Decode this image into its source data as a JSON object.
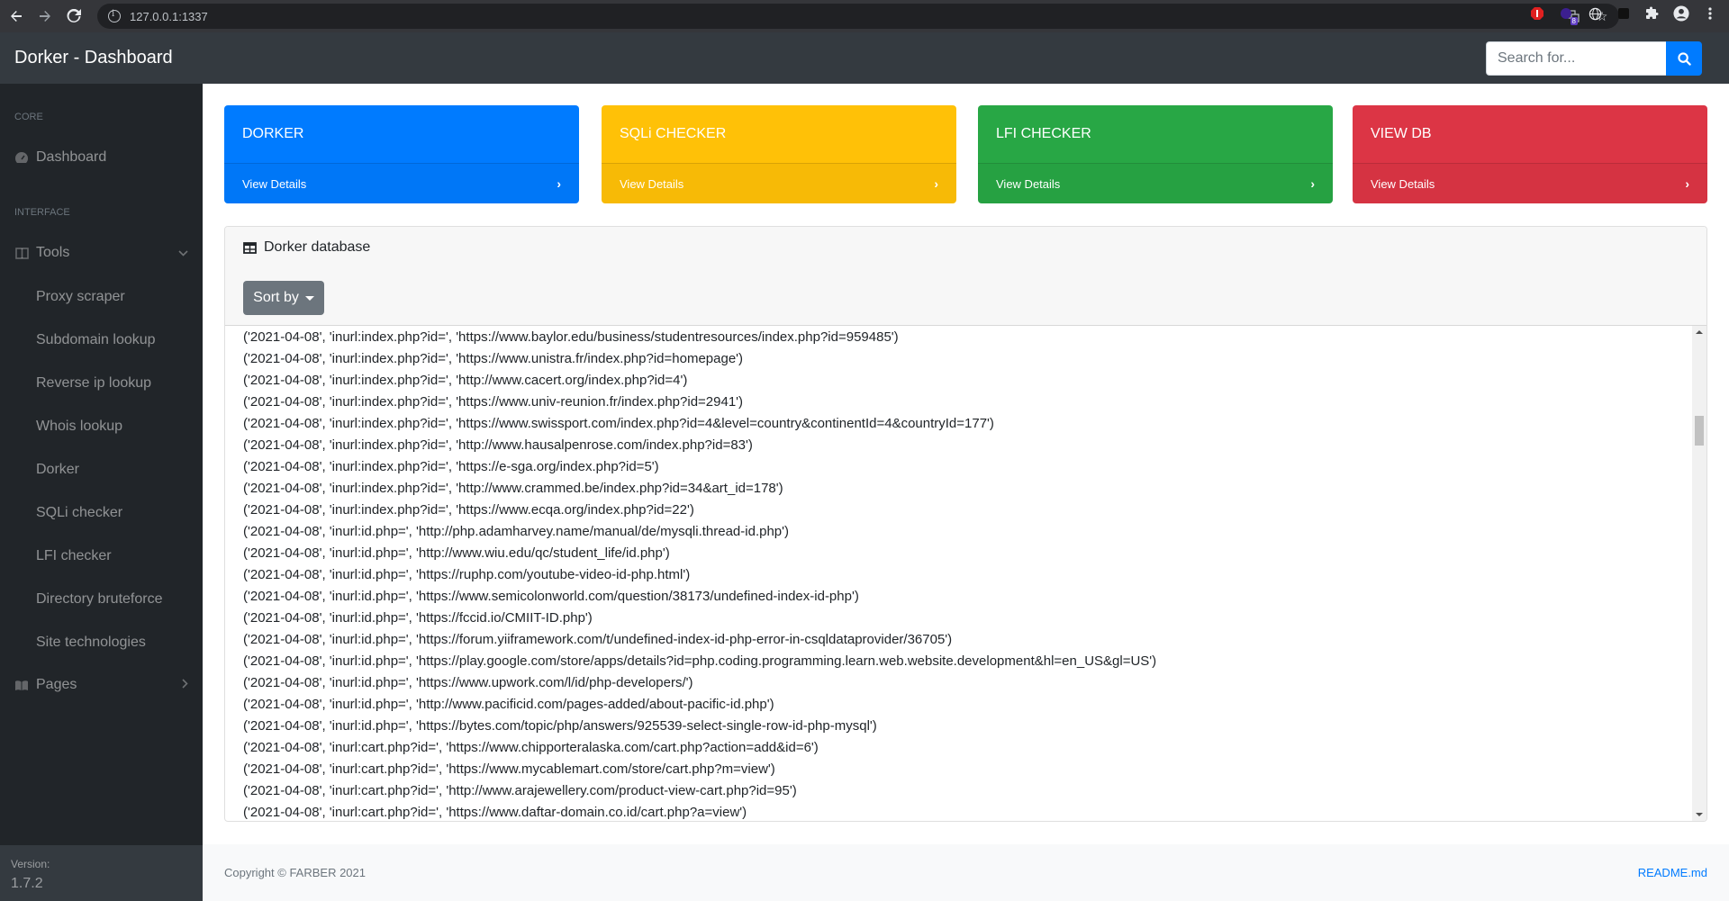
{
  "browser": {
    "url": "127.0.0.1:1337",
    "extension_badge": "8"
  },
  "topnav": {
    "brand": "Dorker - Dashboard",
    "search_placeholder": "Search for..."
  },
  "sidebar": {
    "heading_core": "Core",
    "heading_interface": "Interface",
    "dashboard": "Dashboard",
    "tools": "Tools",
    "tools_items": [
      "Proxy scraper",
      "Subdomain lookup",
      "Reverse ip lookup",
      "Whois lookup",
      "Dorker",
      "SQLi checker",
      "LFI checker",
      "Directory bruteforce",
      "Site technologies"
    ],
    "pages": "Pages",
    "version_label": "Version:",
    "version": "1.7.2"
  },
  "cards": [
    {
      "title": "DORKER",
      "link": "View Details",
      "color": "#007bff",
      "text": "#ffffff"
    },
    {
      "title": "SQLi CHECKER",
      "link": "View Details",
      "color": "#ffc107",
      "text": "#ffffff"
    },
    {
      "title": "LFI CHECKER",
      "link": "View Details",
      "color": "#28a745",
      "text": "#ffffff"
    },
    {
      "title": "VIEW DB",
      "link": "View Details",
      "color": "#dc3545",
      "text": "#ffffff"
    }
  ],
  "db": {
    "title": "Dorker database",
    "sort_label": "Sort by",
    "rows": [
      "('2021-04-08', 'inurl:index.php?id=', 'https://www.baylor.edu/business/studentresources/index.php?id=959485')",
      "('2021-04-08', 'inurl:index.php?id=', 'https://www.unistra.fr/index.php?id=homepage')",
      "('2021-04-08', 'inurl:index.php?id=', 'http://www.cacert.org/index.php?id=4')",
      "('2021-04-08', 'inurl:index.php?id=', 'https://www.univ-reunion.fr/index.php?id=2941')",
      "('2021-04-08', 'inurl:index.php?id=', 'https://www.swissport.com/index.php?id=4&level=country&continentId=4&countryId=177')",
      "('2021-04-08', 'inurl:index.php?id=', 'http://www.hausalpenrose.com/index.php?id=83')",
      "('2021-04-08', 'inurl:index.php?id=', 'https://e-sga.org/index.php?id=5')",
      "('2021-04-08', 'inurl:index.php?id=', 'http://www.crammed.be/index.php?id=34&art_id=178')",
      "('2021-04-08', 'inurl:index.php?id=', 'https://www.ecqa.org/index.php?id=22')",
      "('2021-04-08', 'inurl:id.php=', 'http://php.adamharvey.name/manual/de/mysqli.thread-id.php')",
      "('2021-04-08', 'inurl:id.php=', 'http://www.wiu.edu/qc/student_life/id.php')",
      "('2021-04-08', 'inurl:id.php=', 'https://ruphp.com/youtube-video-id-php.html')",
      "('2021-04-08', 'inurl:id.php=', 'https://www.semicolonworld.com/question/38173/undefined-index-id-php')",
      "('2021-04-08', 'inurl:id.php=', 'https://fccid.io/CMIIT-ID.php')",
      "('2021-04-08', 'inurl:id.php=', 'https://forum.yiiframework.com/t/undefined-index-id-php-error-in-csqldataprovider/36705')",
      "('2021-04-08', 'inurl:id.php=', 'https://play.google.com/store/apps/details?id=php.coding.programming.learn.web.website.development&hl=en_US&gl=US')",
      "('2021-04-08', 'inurl:id.php=', 'https://www.upwork.com/l/id/php-developers/')",
      "('2021-04-08', 'inurl:id.php=', 'http://www.pacificid.com/pages-added/about-pacific-id.php')",
      "('2021-04-08', 'inurl:id.php=', 'https://bytes.com/topic/php/answers/925539-select-single-row-id-php-mysql')",
      "('2021-04-08', 'inurl:cart.php?id=', 'https://www.chipporteralaska.com/cart.php?action=add&id=6')",
      "('2021-04-08', 'inurl:cart.php?id=', 'https://www.mycablemart.com/store/cart.php?m=view')",
      "('2021-04-08', 'inurl:cart.php?id=', 'http://www.arajewellery.com/product-view-cart.php?id=95')",
      "('2021-04-08', 'inurl:cart.php?id=', 'https://www.daftar-domain.co.id/cart.php?a=view')"
    ]
  },
  "footer": {
    "copyright": "Copyright © FARBER 2021",
    "readme": "README.md"
  }
}
